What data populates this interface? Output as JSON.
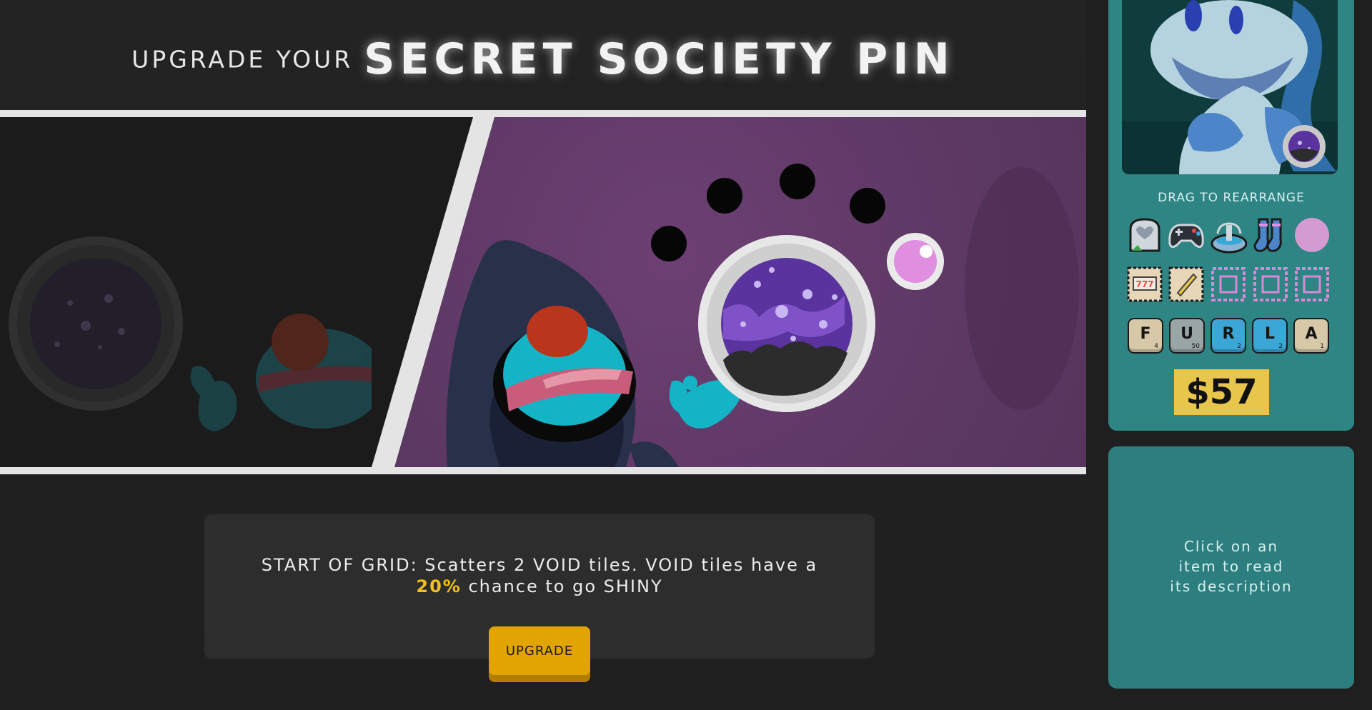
{
  "header": {
    "prefix": "UPGRADE YOUR",
    "title": "SECRET SOCIETY PIN"
  },
  "description": {
    "text_before": "START OF GRID: Scatters 2 VOID tiles. VOID tiles have a",
    "highlight": "20%",
    "text_after": "chance to go SHINY",
    "highlight_color": "#f1c21b"
  },
  "upgrade_button": {
    "label": "UPGRADE"
  },
  "sidebar": {
    "drag_label": "DRAG TO REARRANGE",
    "inventory_row1": [
      "tombstone-icon",
      "gamepad-icon",
      "fountain-icon",
      "socks-icon",
      "pink-orb-icon"
    ],
    "inventory_row2": [
      "slot-machine-stamp-icon",
      "pen-stamp-icon",
      "empty-stamp-slot-icon",
      "empty-stamp-slot-icon",
      "empty-stamp-slot-icon"
    ],
    "letter_tiles": [
      {
        "letter": "F",
        "score": "4",
        "color": "#d8c8a6"
      },
      {
        "letter": "U",
        "score": "50",
        "color": "#9aa6a6"
      },
      {
        "letter": "R",
        "score": "2",
        "color": "#3aa7d6"
      },
      {
        "letter": "L",
        "score": "2",
        "color": "#3aa7d6"
      },
      {
        "letter": "A",
        "score": "1",
        "color": "#d8c8a6"
      }
    ],
    "price": "$57",
    "info": [
      "Click on an",
      "item to read",
      "its description"
    ]
  },
  "colors": {
    "background": "#222222",
    "sidebar_card": "#2f8484",
    "accent_yellow": "#e2a400",
    "price_yellow": "#e8c64b",
    "scene_purple": "#5b3862"
  }
}
